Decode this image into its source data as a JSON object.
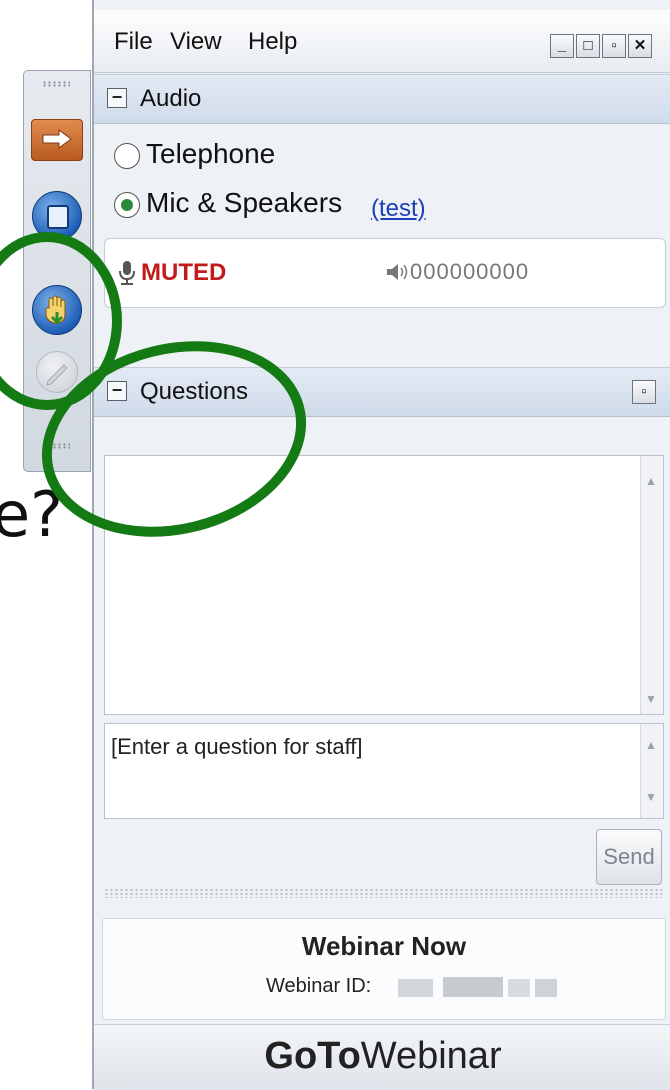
{
  "menu": {
    "items": [
      "File",
      "View",
      "Help"
    ]
  },
  "window_controls": [
    "minimize-icon",
    "maximize-icon",
    "restore-icon",
    "close-icon"
  ],
  "audio": {
    "title": "Audio",
    "options": [
      {
        "label": "Telephone",
        "checked": false
      },
      {
        "label": "Mic & Speakers",
        "checked": true
      }
    ],
    "test_link": "(test)",
    "status": "MUTED",
    "level": "000000000"
  },
  "questions": {
    "title": "Questions",
    "input_placeholder": "[Enter a question for staff]",
    "send_label": "Send"
  },
  "info": {
    "webinar_title": "Webinar Now",
    "webinar_id_label": "Webinar ID:"
  },
  "footer": {
    "logo_bold": "GoTo",
    "logo_regular": "Webinar"
  },
  "overlay": {
    "text": "e?"
  },
  "colors": {
    "accent_green": "#147a14",
    "muted_red": "#c21b1b",
    "link_blue": "#1a3fb8"
  },
  "icons": [
    "arrow-icon",
    "screen-icon",
    "raise-hand-icon",
    "pencil-icon",
    "mic-icon",
    "speaker-icon"
  ]
}
